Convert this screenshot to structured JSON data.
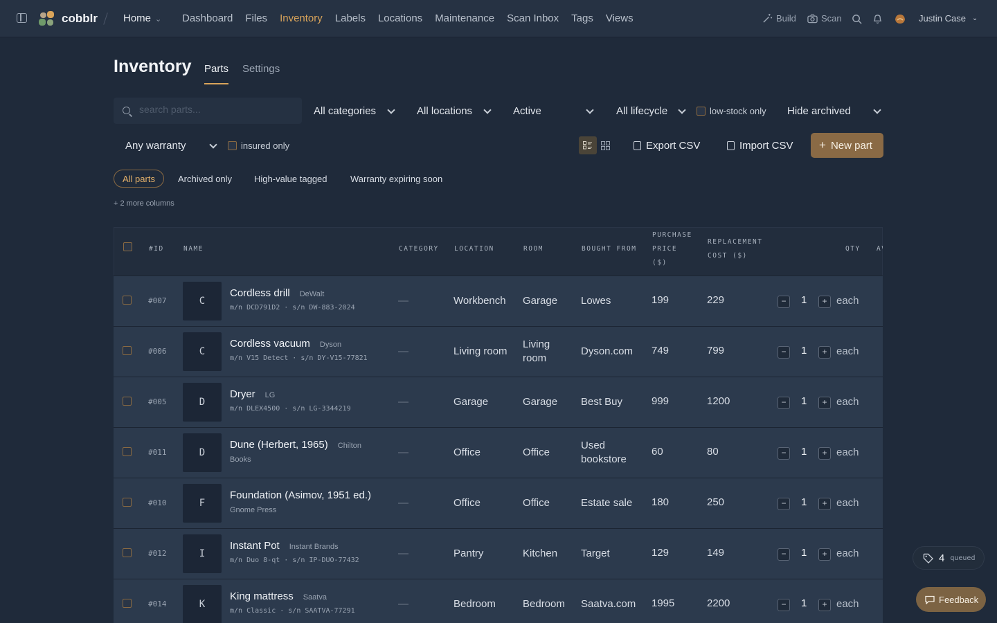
{
  "app": {
    "brand": "cobblr",
    "workspace": "Home"
  },
  "nav": [
    "Dashboard",
    "Files",
    "Inventory",
    "Labels",
    "Locations",
    "Maintenance",
    "Scan Inbox",
    "Tags",
    "Views"
  ],
  "nav_active": "Inventory",
  "topright": {
    "build": "Build",
    "scan": "Scan",
    "user": "Justin Case"
  },
  "page": {
    "title": "Inventory",
    "tabs": [
      "Parts",
      "Settings"
    ],
    "active_tab": "Parts"
  },
  "filters": {
    "search_placeholder": "search parts...",
    "category": "All categories",
    "location": "All locations",
    "status": "Active",
    "lifecycle": "All lifecycle",
    "low_stock": "low-stock only",
    "archived": "Hide archived",
    "warranty": "Any warranty",
    "insured": "insured only"
  },
  "actions": {
    "export": "Export CSV",
    "import": "Import CSV",
    "new": "New part"
  },
  "chips": [
    "All parts",
    "Archived only",
    "High-value tagged",
    "Warranty expiring soon"
  ],
  "more_columns": "+ 2 more columns",
  "columns": {
    "id": "#ID",
    "name": "NAME",
    "category": "CATEGORY",
    "location": "LOCATION",
    "room": "ROOM",
    "bought_from": "BOUGHT FROM",
    "purchase_1": "PURCHASE",
    "purchase_2": "PRICE",
    "purchase_3": "($)",
    "replace_1": "REPLACEMENT",
    "replace_2": "COST ($)",
    "qty": "QTY",
    "av": "AV"
  },
  "rows": [
    {
      "id": "#007",
      "letter": "C",
      "name": "Cordless drill",
      "brand": "DeWalt",
      "meta": "m/n DCD791D2 · s/n DW-883-2024",
      "category": "—",
      "location": "Workbench",
      "room": "Garage",
      "bought_from": "Lowes",
      "price": "199",
      "replacement": "229",
      "qty": "1",
      "unit": "each"
    },
    {
      "id": "#006",
      "letter": "C",
      "name": "Cordless vacuum",
      "brand": "Dyson",
      "meta": "m/n V15 Detect · s/n DY-V15-77821",
      "category": "—",
      "location": "Living room",
      "room": "Living room",
      "bought_from": "Dyson.com",
      "price": "749",
      "replacement": "799",
      "qty": "1",
      "unit": "each"
    },
    {
      "id": "#005",
      "letter": "D",
      "name": "Dryer",
      "brand": "LG",
      "meta": "m/n DLEX4500 · s/n LG-3344219",
      "category": "—",
      "location": "Garage",
      "room": "Garage",
      "bought_from": "Best Buy",
      "price": "999",
      "replacement": "1200",
      "qty": "1",
      "unit": "each"
    },
    {
      "id": "#011",
      "letter": "D",
      "name": "Dune (Herbert, 1965)",
      "brand": "Chilton",
      "meta": "Books",
      "category": "—",
      "location": "Office",
      "room": "Office",
      "bought_from": "Used bookstore",
      "price": "60",
      "replacement": "80",
      "qty": "1",
      "unit": "each"
    },
    {
      "id": "#010",
      "letter": "F",
      "name": "Foundation (Asimov, 1951 ed.)",
      "brand": "",
      "meta": "Gnome Press",
      "category": "—",
      "location": "Office",
      "room": "Office",
      "bought_from": "Estate sale",
      "price": "180",
      "replacement": "250",
      "qty": "1",
      "unit": "each"
    },
    {
      "id": "#012",
      "letter": "I",
      "name": "Instant Pot",
      "brand": "Instant Brands",
      "meta": "m/n Duo 8-qt · s/n IP-DUO-77432",
      "category": "—",
      "location": "Pantry",
      "room": "Kitchen",
      "bought_from": "Target",
      "price": "129",
      "replacement": "149",
      "qty": "1",
      "unit": "each"
    },
    {
      "id": "#014",
      "letter": "K",
      "name": "King mattress",
      "brand": "Saatva",
      "meta": "m/n Classic · s/n SAATVA-77291",
      "category": "—",
      "location": "Bedroom",
      "room": "Bedroom",
      "bought_from": "Saatva.com",
      "price": "1995",
      "replacement": "2200",
      "qty": "1",
      "unit": "each"
    }
  ],
  "queue": {
    "count": "4",
    "label": "queued"
  },
  "feedback": "Feedback",
  "colors": {
    "accent": "#d9a45a",
    "primary_button": "#8a6a45",
    "background": "#1f2a3a"
  }
}
